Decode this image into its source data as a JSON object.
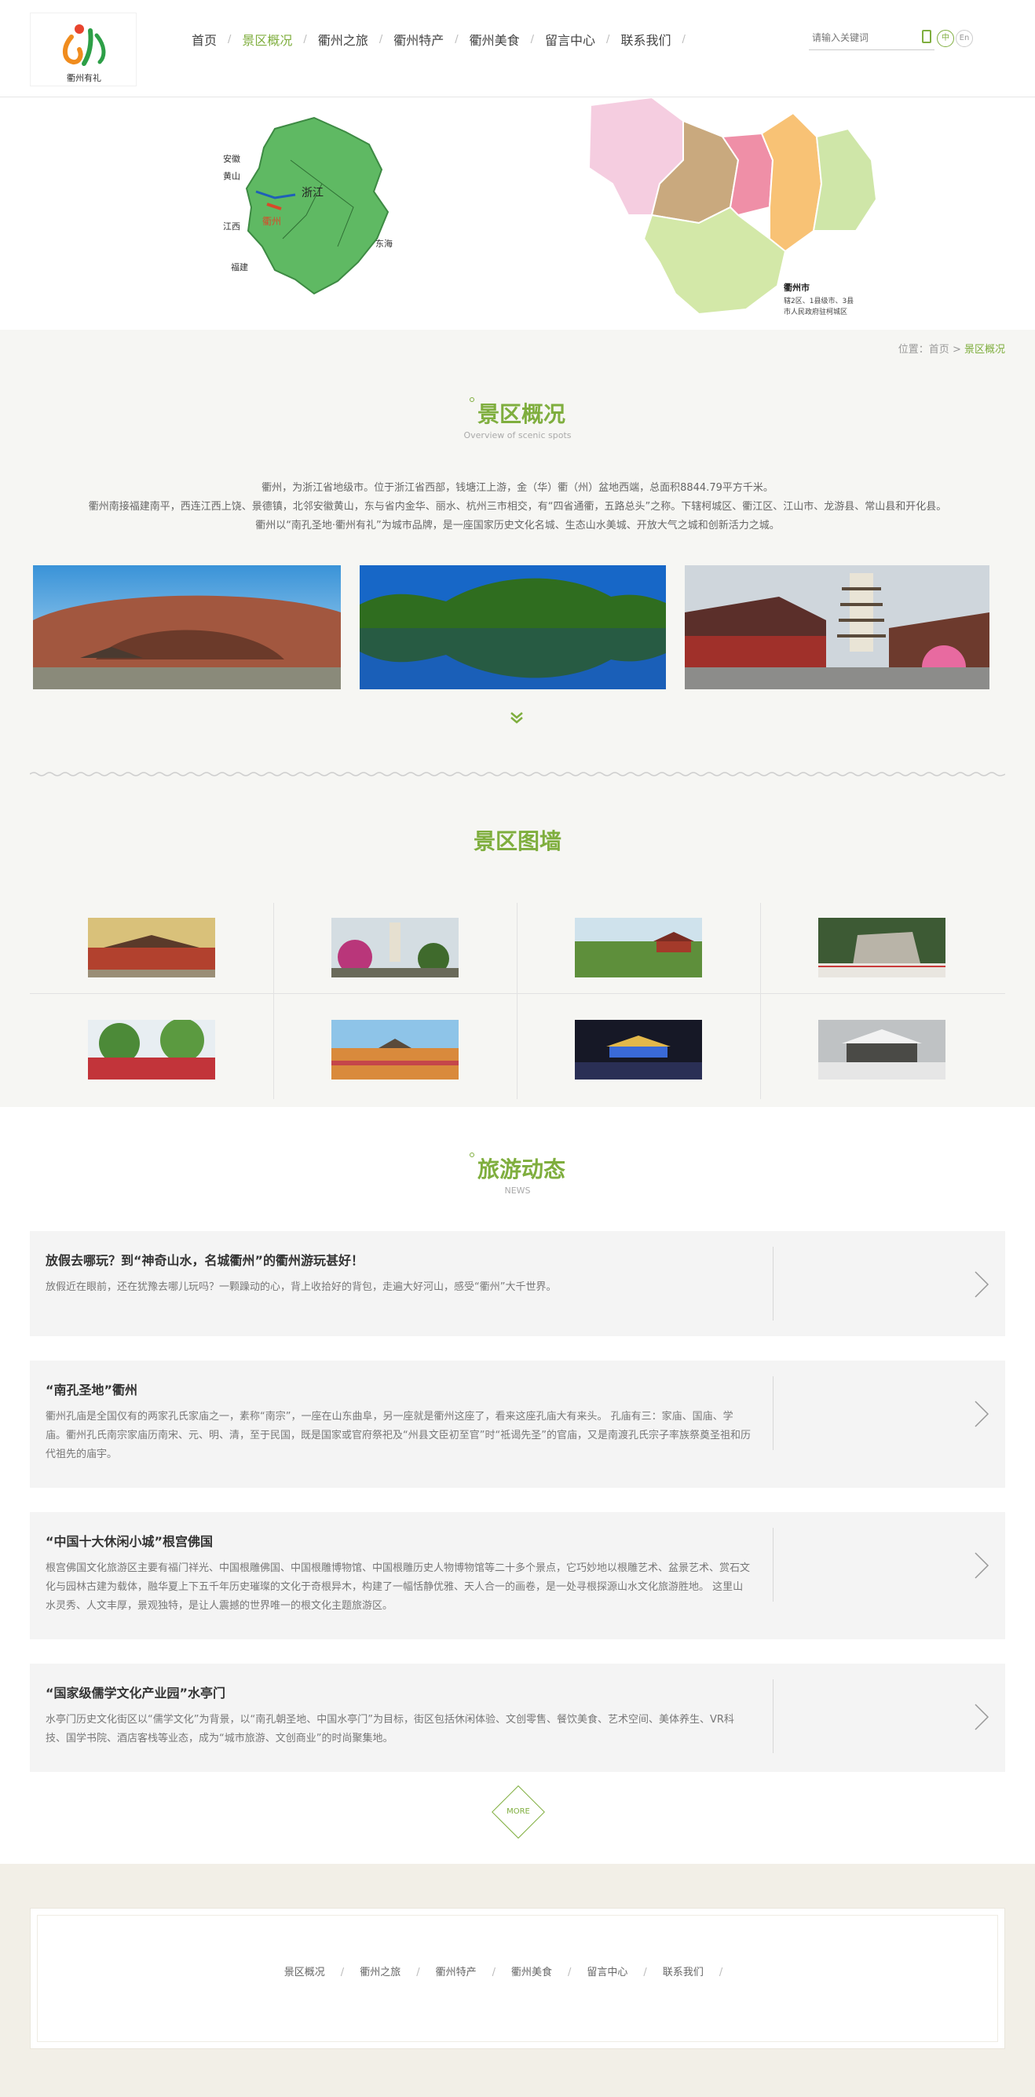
{
  "logo": {
    "text": "衢州有礼"
  },
  "nav": {
    "items": [
      "首页",
      "景区概况",
      "衢州之旅",
      "衢州特产",
      "衢州美食",
      "留言中心",
      "联系我们"
    ],
    "active_index": 1
  },
  "search": {
    "placeholder": "请输入关键词"
  },
  "lang": {
    "zh": "中",
    "en": "En"
  },
  "banner": {
    "left_map_labels": [
      "安徽",
      "黄山",
      "浙江",
      "衢州",
      "江西",
      "福建",
      "东海"
    ],
    "right_map_caption": [
      "衢州市",
      "辖2区、1县级市、3县",
      "市人民政府驻柯城区"
    ]
  },
  "breadcrumb": {
    "prefix": "位置：",
    "home": "首页",
    "sep": ">",
    "current": "景区概况"
  },
  "overview": {
    "title": "景区概况",
    "subtitle": "Overview of scenic spots",
    "paragraphs": [
      "衢州，为浙江省地级市。位于浙江省西部，钱塘江上游，金（华）衢（州）盆地西端，总面积8844.79平方千米。",
      "衢州南接福建南平，西连江西上饶、景德镇，北邻安徽黄山，东与省内金华、丽水、杭州三市相交，有“四省通衢，五路总头”之称。下辖柯城区、衢江区、江山市、龙游县、常山县和开化县。",
      "衢州以“南孔圣地·衢州有礼”为城市品牌，是一座国家历史文化名城、生态山水美城、开放大气之城和创新活力之城。"
    ]
  },
  "gallery": {
    "title": "景区图墙"
  },
  "news": {
    "title": "旅游动态",
    "subtitle": "NEWS",
    "items": [
      {
        "title": "放假去哪玩？到“神奇山水，名城衢州”的衢州游玩甚好！",
        "desc": "放假近在眼前，还在犹豫去哪儿玩吗？一颗躁动的心，背上收拾好的背包，走遍大好河山，感受“衢州”大千世界。"
      },
      {
        "title": "“南孔圣地”衢州",
        "desc": "衢州孔庙是全国仅有的两家孔氏家庙之一，素称“南宗”，一座在山东曲阜，另一座就是衢州这座了，看来这座孔庙大有来头。 孔庙有三：家庙、国庙、学庙。衢州孔氏南宗家庙历南宋、元、明、清，至于民国，既是国家或官府祭祀及“州县文臣初至官”时“祗谒先圣”的官庙，又是南渡孔氏宗子率族祭奠圣祖和历代祖先的庙宇。"
      },
      {
        "title": "“中国十大休闲小城”根宫佛国",
        "desc": "根宫佛国文化旅游区主要有福门祥光、中国根雕佛国、中国根雕博物馆、中国根雕历史人物博物馆等二十多个景点，它巧妙地以根雕艺术、盆景艺术、赏石文化与园林古建为载体，融华夏上下五千年历史璀璨的文化于奇根异木，构建了一幅恬静优雅、天人合一的画卷，是一处寻根探源山水文化旅游胜地。 这里山水灵秀、人文丰厚，景观独特，是让人震撼的世界唯一的根文化主题旅游区。"
      },
      {
        "title": "“国家级儒学文化产业园”水亭门",
        "desc": "水亭门历史文化街区以“儒学文化”为背景，以“南孔朝圣地、中国水亭门”为目标，街区包括休闲体验、文创零售、餐饮美食、艺术空间、美体养生、VR科技、国学书院、酒店客栈等业态，成为“城市旅游、文创商业”的时尚聚集地。"
      }
    ],
    "more": "MORE"
  },
  "footer": {
    "links": [
      "景区概况",
      "衢州之旅",
      "衢州特产",
      "衢州美食",
      "留言中心",
      "联系我们"
    ],
    "sep": "/"
  },
  "colors": {
    "accent": "#7fae3e",
    "text": "#555555",
    "section_bg": "#f6f6f3",
    "footer_bg": "#f2efe7"
  }
}
